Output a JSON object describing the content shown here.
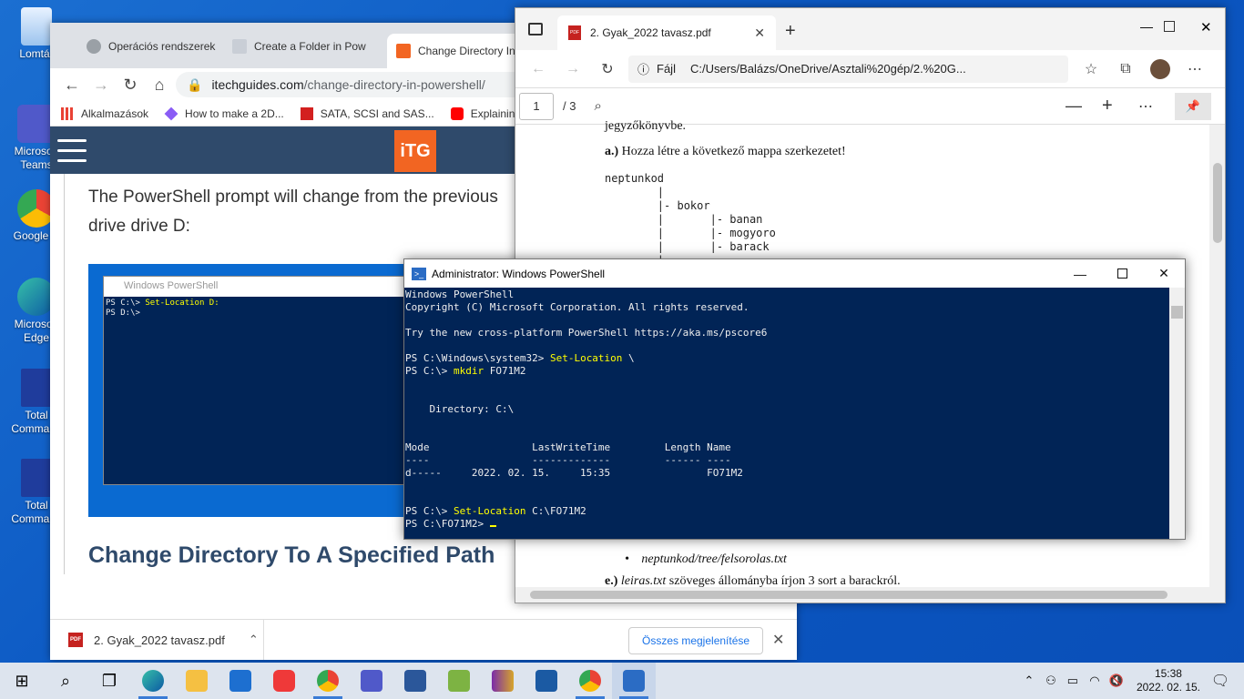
{
  "desktop": {
    "icons": [
      {
        "label": "Lomtár"
      },
      {
        "label": "Microsoft Teams"
      },
      {
        "label": "Google C"
      },
      {
        "label": "Microsoft Edge"
      },
      {
        "label": "Total Command"
      },
      {
        "label": "Total Command"
      }
    ]
  },
  "chrome": {
    "tabs": [
      {
        "label": "Operációs rendszerek"
      },
      {
        "label": "Create a Folder in Pow"
      },
      {
        "label": "Change Directory In"
      }
    ],
    "url_host": "itechguides.com",
    "url_path": "/change-directory-in-powershell/",
    "bookmarks": [
      {
        "label": "Alkalmazások"
      },
      {
        "label": "How to make a 2D..."
      },
      {
        "label": "SATA, SCSI and SAS..."
      },
      {
        "label": "ExplainingC"
      }
    ],
    "logo": "iTG",
    "article_text": "The PowerShell prompt will change from the previous drive drive D:",
    "screenshot_title": "Windows PowerShell",
    "screenshot_line1_prompt": "PS C:\\> ",
    "screenshot_line1_cmd": "Set-Location D:",
    "screenshot_line2": "PS D:\\>",
    "heading": "Change Directory To A Specified Path",
    "download_file": "2. Gyak_2022 tavasz.pdf",
    "show_all": "Összes megjelenítése"
  },
  "edge": {
    "tab_title": "2. Gyak_2022 tavasz.pdf",
    "address_label": "Fájl",
    "address": "C:/Users/Balázs/OneDrive/Asztali%20gép/2.%20G...",
    "page_current": "1",
    "page_total": "/ 3",
    "pdf_top_line": "jegyzőkönyvbe.",
    "pdf_task_a_label": "a.)",
    "pdf_task_a": "Hozza létre a következő mappa szerkezetet!",
    "pdf_tree": "neptunkod\n        |\n        |- bokor\n        |       |- banan\n        |       |- mogyoro\n        |       |- barack\n        |",
    "pdf_bullet": "neptunkod/tree/felsorolas.txt",
    "pdf_task_e_label": "e.)",
    "pdf_task_e_file": "leiras.txt",
    "pdf_task_e": "szöveges állományba írjon 3 sort a barackról."
  },
  "powershell": {
    "title": "Administrator: Windows PowerShell",
    "lines": {
      "l1": "Windows PowerShell",
      "l2": "Copyright (C) Microsoft Corporation. All rights reserved.",
      "l3": "Try the new cross-platform PowerShell https://aka.ms/pscore6",
      "p1": "PS C:\\Windows\\system32> ",
      "c1": "Set-Location",
      "a1": " \\",
      "p2": "PS C:\\> ",
      "c2": "mkdir",
      "a2": " FO71M2",
      "dir": "    Directory: C:\\",
      "hdr": "Mode                 LastWriteTime         Length Name",
      "sep": "----                 -------------         ------ ----",
      "row": "d-----     2022. 02. 15.     15:35                FO71M2",
      "p3": "PS C:\\> ",
      "c3": "Set-Location",
      "a3": " C:\\FO71M2",
      "p4": "PS C:\\FO71M2> "
    }
  },
  "taskbar": {
    "time": "15:38",
    "date": "2022. 02. 15."
  },
  "colors": {
    "ps_background": "#012456",
    "ps_command": "#ffff00",
    "site_header": "#2f4a6b",
    "itg_orange": "#f26522"
  }
}
